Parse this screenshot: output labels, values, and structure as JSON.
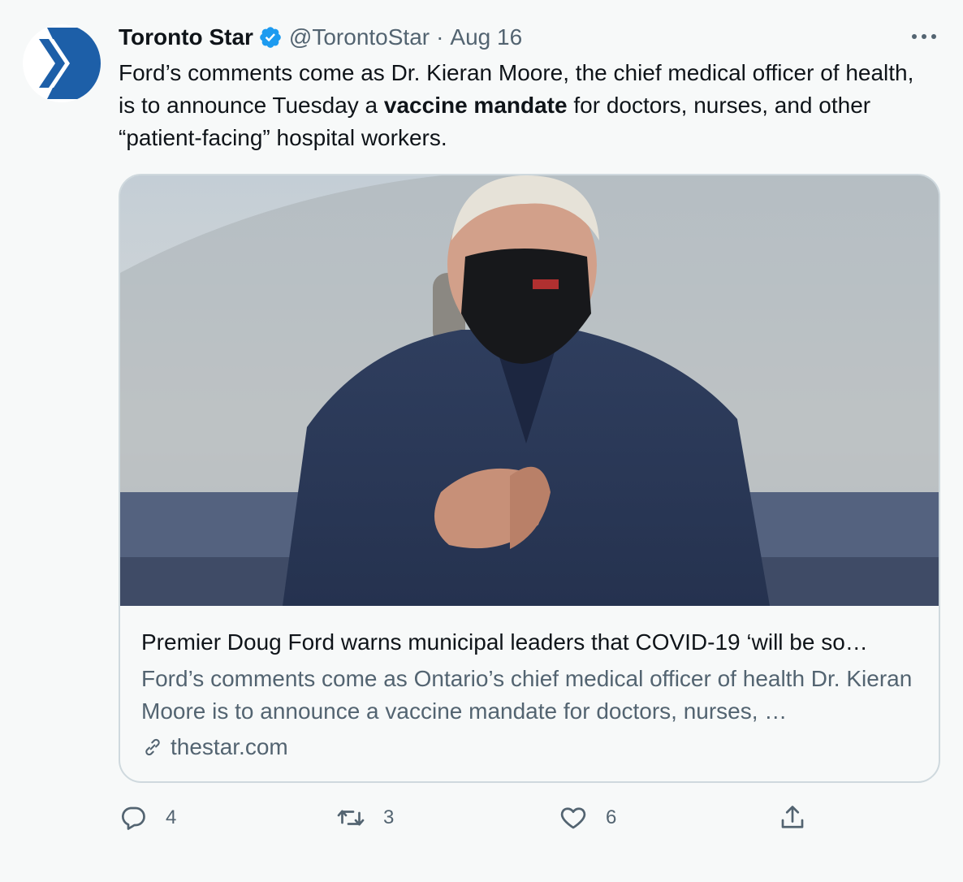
{
  "tweet": {
    "author_name": "Toronto Star",
    "handle": "@TorontoStar",
    "separator": "·",
    "date": "Aug 16",
    "text_before": "Ford’s comments come as Dr. Kieran Moore, the chief medical officer of health, is to announce Tuesday a ",
    "text_bold": "vaccine mandate",
    "text_after": " for doctors, nurses, and other “patient-facing” hospital workers."
  },
  "card": {
    "title": "Premier Doug Ford warns municipal leaders that COVID-19 ‘will be so…",
    "description": "Ford’s comments come as Ontario’s chief medical officer of health Dr. Kieran Moore is to announce a vaccine mandate for doctors, nurses, …",
    "domain": "thestar.com"
  },
  "actions": {
    "reply_count": "4",
    "retweet_count": "3",
    "like_count": "6"
  },
  "icons": {
    "verified": "verified-badge-icon",
    "more": "more-icon",
    "link": "link-icon",
    "reply": "reply-icon",
    "retweet": "retweet-icon",
    "like": "heart-icon",
    "share": "share-icon"
  },
  "colors": {
    "brand_blue": "#1d5fa8",
    "verified_blue": "#1d9bf0",
    "text_primary": "#0f1419",
    "text_secondary": "#536471",
    "border": "#cfd9de",
    "background": "#f7f9f9"
  }
}
